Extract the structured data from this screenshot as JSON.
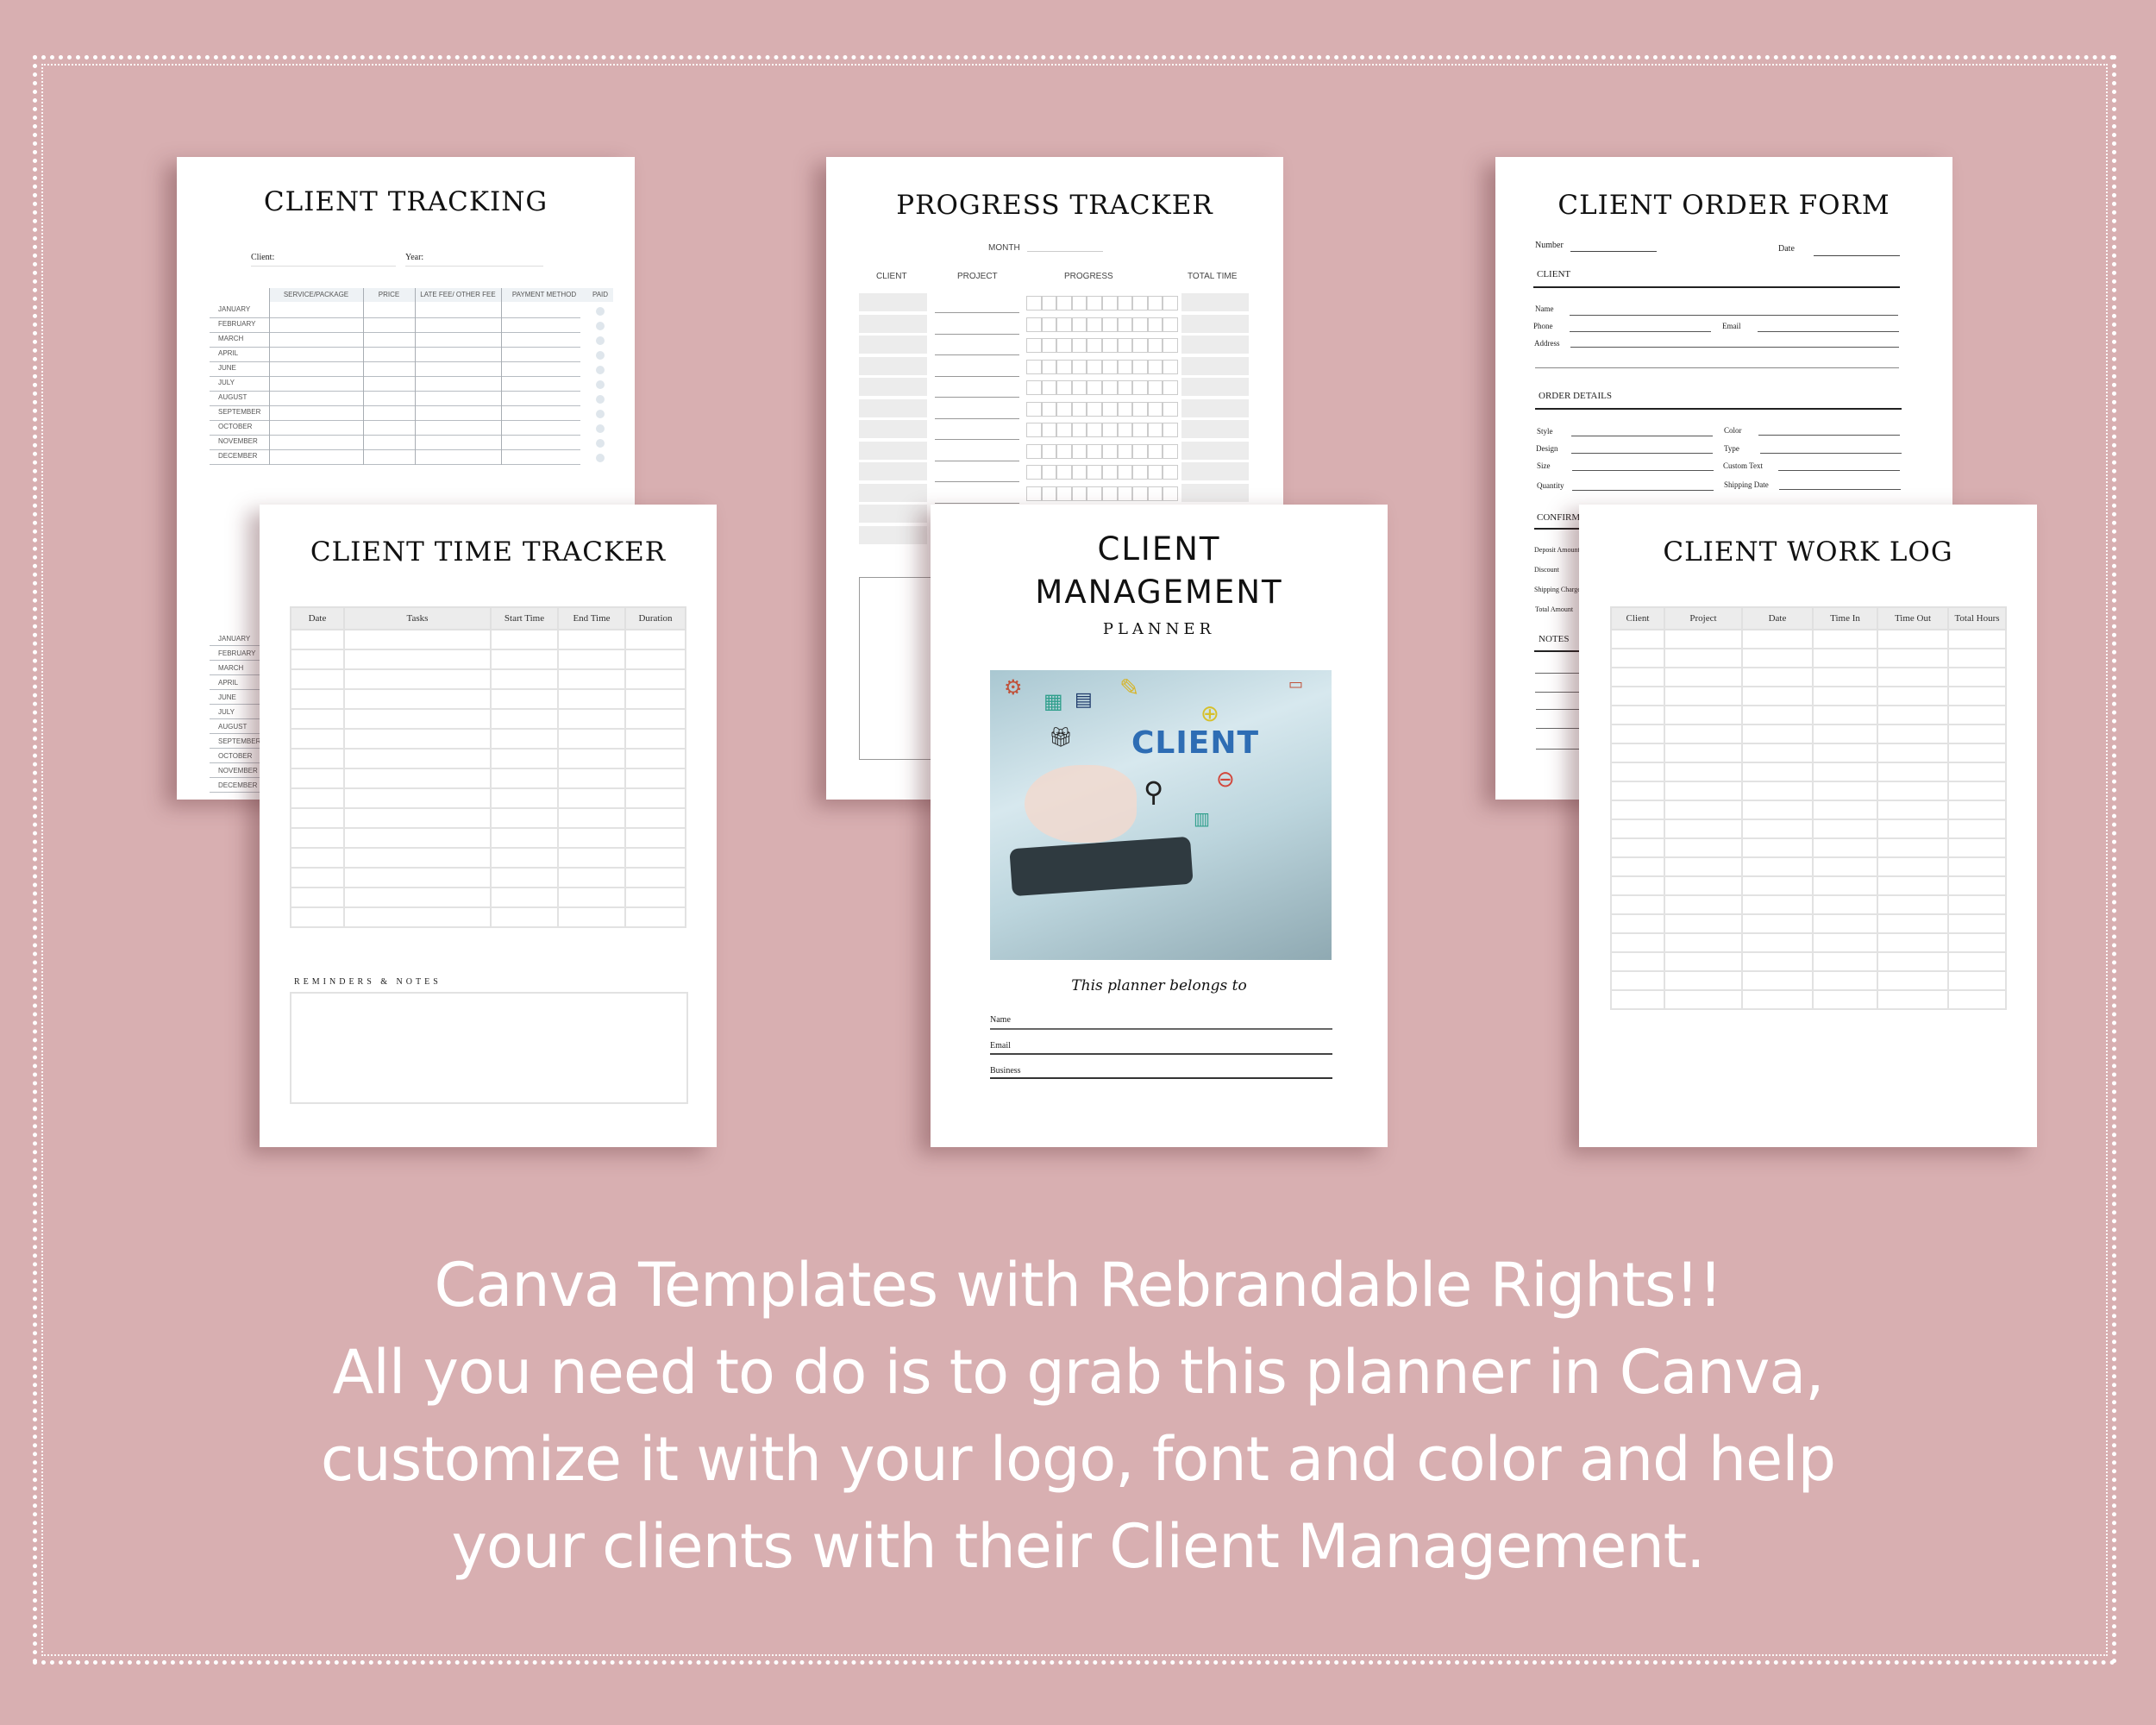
{
  "colors": {
    "background": "#d8afb1",
    "card": "#ffffff",
    "border_dots": "#ffffff",
    "cover_word": "#2e6db4",
    "table_header": "#ececec"
  },
  "client_tracking": {
    "title": "CLIENT TRACKING",
    "client_label": "Client:",
    "year_label": "Year:",
    "columns": [
      "SERVICE/PACKAGE",
      "PRICE",
      "LATE FEE/ OTHER FEE",
      "PAYMENT METHOD",
      "PAID"
    ],
    "months": [
      "JANUARY",
      "FEBRUARY",
      "MARCH",
      "APRIL",
      "JUNE",
      "JULY",
      "AUGUST",
      "SEPTEMBER",
      "OCTOBER",
      "NOVEMBER",
      "DECEMBER"
    ]
  },
  "progress_tracker": {
    "title": "PROGRESS TRACKER",
    "month_label": "MONTH",
    "columns": [
      "CLIENT",
      "PROJECT",
      "PROGRESS",
      "TOTAL TIME"
    ],
    "progress_boxes": 10
  },
  "order_form": {
    "title": "CLIENT ORDER FORM",
    "number_label": "Number",
    "date_label": "Date",
    "client_section": "CLIENT",
    "name_label": "Name",
    "phone_label": "Phone",
    "email_label": "Email",
    "address_label": "Address",
    "order_section": "ORDER DETAILS",
    "style_label": "Style",
    "color_label": "Color",
    "design_label": "Design",
    "type_label": "Type",
    "size_label": "Size",
    "custom_text_label": "Custom Text",
    "quantity_label": "Quantity",
    "shipping_date_label": "Shipping Date",
    "confirm_section": "CONFIRM",
    "deposit_label": "Deposit Amount",
    "discount_label": "Discount",
    "shipping_charge_label": "Shipping Charge",
    "total_label": "Total Amount",
    "notes_section": "NOTES"
  },
  "time_tracker": {
    "title": "CLIENT TIME TRACKER",
    "columns": [
      "Date",
      "Tasks",
      "Start Time",
      "End Time",
      "Duration"
    ],
    "row_count": 15,
    "notes_label": "REMINDERS & NOTES"
  },
  "cover": {
    "title_line1": "CLIENT",
    "title_line2": "MANAGEMENT",
    "subtitle": "PLANNER",
    "image_word": "CLIENT",
    "belongs_to": "This planner belongs to",
    "fields": [
      "Name",
      "Email",
      "Business"
    ]
  },
  "work_log": {
    "title": "CLIENT WORK LOG",
    "columns": [
      "Client",
      "Project",
      "Date",
      "Time In",
      "Time Out",
      "Total Hours"
    ],
    "row_count": 20
  },
  "promo": {
    "lines": [
      "Canva Templates with Rebrandable Rights!!",
      "All you need to do is to grab this planner in Canva,",
      "customize it with your logo, font and color and help",
      "your clients with their Client Management."
    ]
  }
}
